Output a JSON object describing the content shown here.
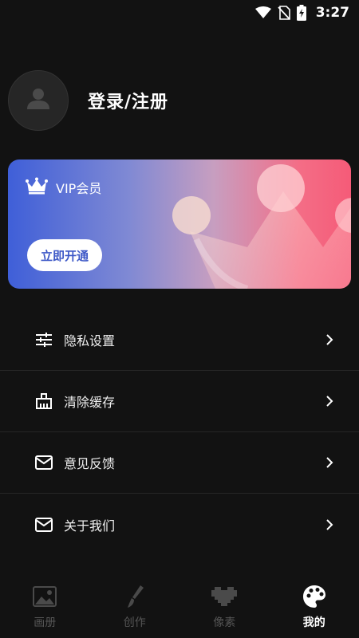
{
  "status_bar": {
    "time": "3:27",
    "icons": [
      "wifi-icon",
      "no-sim-icon",
      "battery-charging-icon"
    ]
  },
  "profile": {
    "avatar_icon": "user-icon",
    "login_label": "登录/注册"
  },
  "vip": {
    "icon": "crown-icon",
    "title": "VIP会员",
    "button_label": "立即开通",
    "gradient_colors": [
      "#3f5fd8",
      "#f55b78"
    ]
  },
  "menu": {
    "items": [
      {
        "icon": "sliders-icon",
        "label": "隐私设置"
      },
      {
        "icon": "broom-icon",
        "label": "清除缓存"
      },
      {
        "icon": "mail-icon",
        "label": "意见反馈"
      },
      {
        "icon": "mail-icon",
        "label": "关于我们"
      }
    ]
  },
  "bottom_nav": {
    "items": [
      {
        "icon": "image-icon",
        "label": "画册",
        "active": false
      },
      {
        "icon": "brush-icon",
        "label": "创作",
        "active": false
      },
      {
        "icon": "pixel-heart-icon",
        "label": "像素",
        "active": false
      },
      {
        "icon": "palette-icon",
        "label": "我的",
        "active": true
      }
    ]
  }
}
